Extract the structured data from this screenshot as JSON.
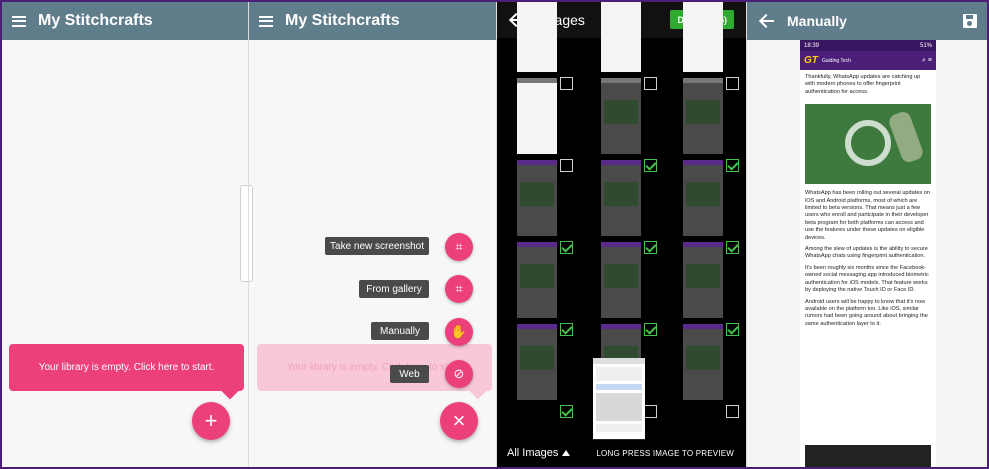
{
  "panel1": {
    "app_title": "My Stitchcrafts",
    "empty_message": "Your library is empty. Click here to start.",
    "fab_icon": "plus-icon",
    "fab_symbol": "+"
  },
  "panel2": {
    "app_title": "My Stitchcrafts",
    "empty_message": "Your library is empty. Click here to start.",
    "menu": [
      {
        "label": "Take new screenshot",
        "icon": "screenshot-icon",
        "symbol": "⌗"
      },
      {
        "label": "From gallery",
        "icon": "gallery-icon",
        "symbol": "⌗"
      },
      {
        "label": "Manually",
        "icon": "hand-icon",
        "symbol": "✋"
      },
      {
        "label": "Web",
        "icon": "compass-icon",
        "symbol": "⊘"
      }
    ],
    "close_symbol": "×"
  },
  "panel3": {
    "title": "Images",
    "done_label": "DONE(8/15)",
    "album_label": "All Images",
    "hint": "LONG PRESS IMAGE TO PREVIEW",
    "checked": [
      false,
      false,
      false,
      false,
      true,
      true,
      true,
      true,
      true,
      true,
      true,
      true,
      true,
      false,
      false
    ]
  },
  "panel4": {
    "title": "Manually",
    "status_time": "18:39",
    "status_right": "51%",
    "site_logo": "GT",
    "site_name": "Guiding Tech",
    "para1": "Thankfully, WhatsApp updates are catching up with modern phones to offer fingerprint authentication for access.",
    "para2": "WhatsApp has been rolling out several updates on iOS and Android platforms, most of which are limited to beta versions. That means just a few users who enroll and participate in their developer beta program for both platforms can access and use the features under these updates on eligible devices.",
    "para3": "Among the slew of updates is the ability to secure WhatsApp chats using fingerprint authentication.",
    "para4": "It's been roughly six months since the Facebook-owned social messaging app introduced biometric authentication for iOS models. That feature works by deploying the native Touch ID or Face ID.",
    "para5": "Android users will be happy to know that it's now available on the platform too. Like iOS, similar rumors had been going around about bringing the same authentication layer to it."
  },
  "colors": {
    "appbar": "#607d8b",
    "accent_pink": "#ec407a",
    "check_green": "#48c14b",
    "done_green": "#2eaa2e",
    "gt_purple": "#4b1f78"
  }
}
